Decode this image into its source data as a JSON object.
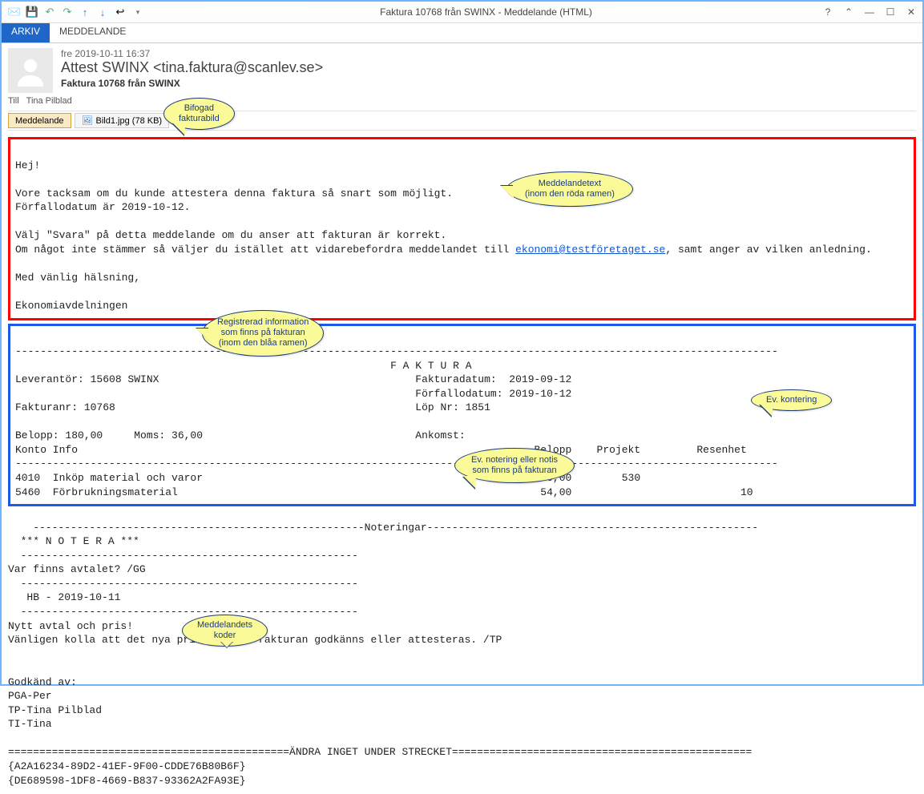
{
  "window": {
    "title": "Faktura 10768 från SWINX - Meddelande (HTML)"
  },
  "qat_icons": [
    "mail-icon",
    "save-icon",
    "undo-icon",
    "redo-icon",
    "up-arrow-icon",
    "down-arrow-icon",
    "reply-icon",
    "expand-icon"
  ],
  "tabs": {
    "arkiv": "ARKIV",
    "meddelande": "MEDDELANDE"
  },
  "message": {
    "datetime": "fre 2019-10-11 16:37",
    "from": "Attest SWINX <tina.faktura@scanlev.se>",
    "subject": "Faktura 10768 från SWINX",
    "to_label": "Till",
    "to_value": "Tina Pilblad"
  },
  "attachments": {
    "tab_label": "Meddelande",
    "file_label": "Bild1.jpg (78 KB)"
  },
  "callouts": {
    "bifogad": "Bifogad\nfakturabild",
    "medtext": "Meddelandetext\n(inom den röda ramen)",
    "reginfo": "Registrerad information\nsom finns på fakturan\n(inom den blåa ramen)",
    "kontering": "Ev. kontering",
    "notering": "Ev. notering eller notis\nsom finns på fakturan",
    "koder": "Meddelandets\nkoder"
  },
  "body_red": {
    "l1": "Hej!",
    "l2": "Vore tacksam om du kunde attestera denna faktura så snart som möjligt.",
    "l3": "Förfallodatum är 2019-10-12.",
    "l4": "Välj \"Svara\" på detta meddelande om du anser att fakturan är korrekt.",
    "l5a": "Om något inte stämmer så väljer du istället att vidarebefordra meddelandet till ",
    "l5link": "ekonomi@testföretaget.se",
    "l5b": ", samt anger av vilken anledning.",
    "l6": "Med vänlig hälsning,",
    "l7": "Ekonomiavdelningen"
  },
  "body_blue": {
    "sep_top": "--------------------------------------------------------------------------------------------------------------------------",
    "title": "                                                            F A K T U R A",
    "lev": "Leverantör: 15608 SWINX                                         Fakturadatum:  2019-09-12",
    "forf": "                                                                Förfallodatum: 2019-10-12",
    "fnr": "Fakturanr: 10768                                                Löp Nr: 1851",
    "blank1": " ",
    "belopp": "Belopp: 180,00     Moms: 36,00                                  Ankomst:",
    "head": "Konto Info                                                                         Belopp    Projekt         Resenhet",
    "sep_mid": "--------------------------------------------------------------------------------------------------------------------------",
    "row1": "4010  Inköp material och varor                                                      90,00        530",
    "row2": "5460  Förbrukningsmaterial                                                          54,00                           10"
  },
  "notes": {
    "sep_not": "    -----------------------------------------------------Noteringar-----------------------------------------------------",
    "note_hdr": "  *** N O T E R A ***",
    "sep1": "  ------------------------------------------------------",
    "n1": "Var finns avtalet? /GG",
    "sep2": "  ------------------------------------------------------",
    "n2": "   HB - 2019-10-11",
    "sep3": "  ------------------------------------------------------",
    "n3": "Nytt avtal och pris!",
    "n4": "Vänligen kolla att det nya priset innan fakturan godkänns eller attesteras. /TP",
    "blank": " ",
    "godk": "Godkänd av:",
    "g1": "PGA-Per",
    "g2": "TP-Tina Pilblad",
    "g3": "TI-Tina"
  },
  "footer": {
    "sep": "=============================================ÄNDRA INGET UNDER STRECKET================================================",
    "code1": "{A2A16234-89D2-41EF-9F00-CDDE76B80B6F}",
    "code2": "{DE689598-1DF8-4669-B837-93362A2FA93E}"
  }
}
